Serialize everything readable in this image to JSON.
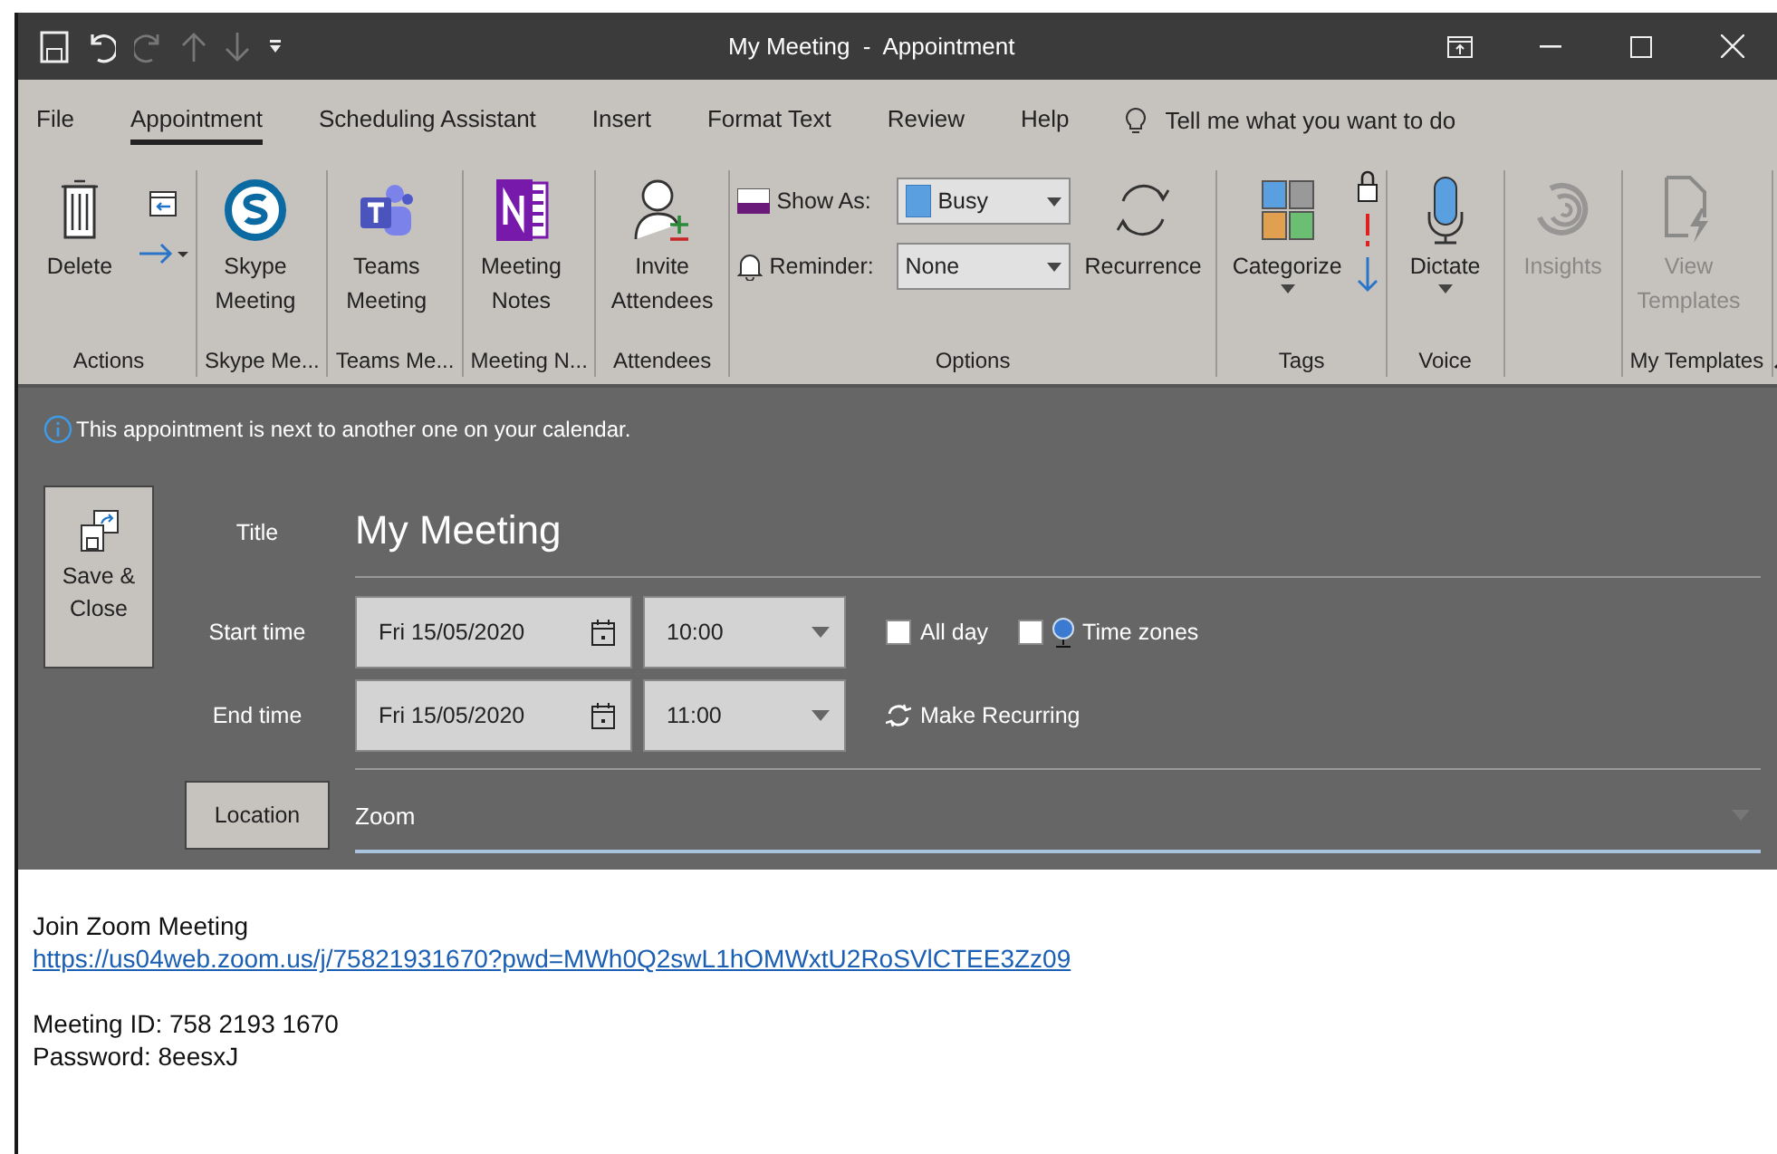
{
  "window": {
    "title": "My Meeting  -  Appointment"
  },
  "quick_access": [
    {
      "kind": "save",
      "disabled": false
    },
    {
      "kind": "undo",
      "disabled": false
    },
    {
      "kind": "redo",
      "disabled": true
    },
    {
      "kind": "up",
      "disabled": true
    },
    {
      "kind": "down",
      "disabled": true
    },
    {
      "kind": "customize",
      "disabled": false
    }
  ],
  "menu_tabs": [
    {
      "label": "File",
      "selected": false
    },
    {
      "label": "Appointment",
      "selected": true
    },
    {
      "label": "Scheduling Assistant",
      "selected": false
    },
    {
      "label": "Insert",
      "selected": false
    },
    {
      "label": "Format Text",
      "selected": false
    },
    {
      "label": "Review",
      "selected": false
    },
    {
      "label": "Help",
      "selected": false
    }
  ],
  "tell_me": "Tell me what you want to do",
  "ribbon_groups": [
    {
      "label": "Actions",
      "items": [
        {
          "kind": "delete",
          "label": "Delete",
          "disabled": false
        },
        {
          "kind": "move"
        }
      ]
    },
    {
      "label": "Skype Me...",
      "items": [
        {
          "kind": "skype",
          "label": "Skype Meeting",
          "disabled": false
        }
      ]
    },
    {
      "label": "Teams Me...",
      "items": [
        {
          "kind": "teams",
          "label": "Teams Meeting",
          "disabled": false
        }
      ]
    },
    {
      "label": "Meeting N...",
      "items": [
        {
          "kind": "notes",
          "label": "Meeting Notes",
          "disabled": false
        }
      ]
    },
    {
      "label": "Attendees",
      "items": [
        {
          "kind": "invite",
          "label": "Invite Attendees",
          "disabled": false
        }
      ]
    },
    {
      "label": "Options",
      "items": [
        {
          "kind": "fields",
          "show_as": {
            "label": "Show As:",
            "value": "Busy"
          },
          "reminder": {
            "label": "Reminder:",
            "value": "None"
          }
        },
        {
          "kind": "recurrence",
          "label": "Recurrence",
          "disabled": false
        }
      ]
    },
    {
      "label": "Tags",
      "items": [
        {
          "kind": "categorize",
          "label": "Categorize",
          "disabled": false,
          "dropdown": true
        },
        {
          "kind": "tag-marks"
        }
      ]
    },
    {
      "label": "Voice",
      "items": [
        {
          "kind": "dictate",
          "label": "Dictate",
          "disabled": false,
          "dropdown": true
        }
      ]
    },
    {
      "items": [
        {
          "kind": "insights",
          "label": "Insights",
          "disabled": true
        }
      ]
    },
    {
      "label": "My Templates",
      "items": [
        {
          "kind": "templates",
          "label": "View Templates",
          "disabled": true
        }
      ]
    }
  ],
  "info_bar": "This appointment is next to another one on your calendar.",
  "form": {
    "save_close": "Save & Close",
    "title_label": "Title",
    "title_value": "My Meeting",
    "start": {
      "label": "Start time",
      "date": "Fri 15/05/2020",
      "time": "10:00"
    },
    "end": {
      "label": "End time",
      "date": "Fri 15/05/2020",
      "time": "11:00"
    },
    "all_day": {
      "label": "All day",
      "checked": false
    },
    "time_zones": {
      "label": "Time zones",
      "checked": false
    },
    "make_recurring": "Make Recurring",
    "location_button": "Location",
    "location_value": "Zoom"
  },
  "body": [
    {
      "kind": "text",
      "text": "Join Zoom Meeting"
    },
    {
      "kind": "link",
      "text": "https://us04web.zoom.us/j/75821931670?pwd=MWh0Q2swL1hOMWxtU2RoSVlCTEE3Zz09"
    },
    {
      "kind": "blank"
    },
    {
      "kind": "text",
      "text": "Meeting ID: 758 2193 1670"
    },
    {
      "kind": "text",
      "text": "Password: 8eesxJ"
    }
  ]
}
